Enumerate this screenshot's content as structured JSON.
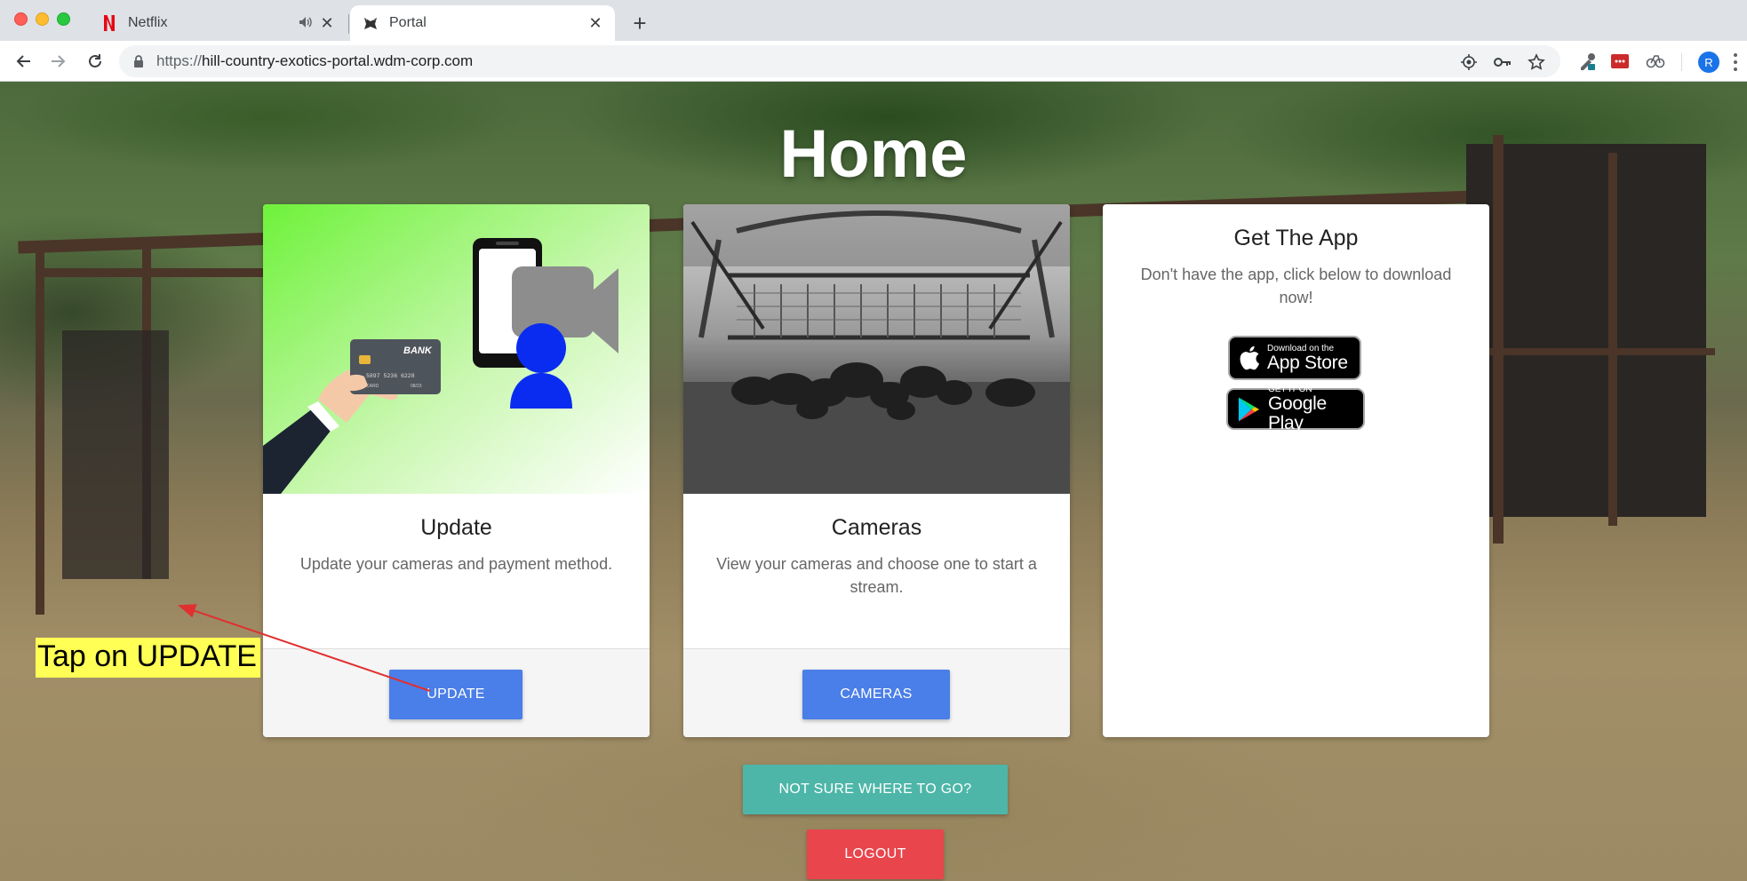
{
  "browser": {
    "tabs": [
      {
        "title": "Netflix",
        "active": false,
        "audio": true
      },
      {
        "title": "Portal",
        "active": true,
        "audio": false
      }
    ],
    "url": {
      "scheme": "https://",
      "host": "hill-country-exotics-portal.wdm-corp.com"
    },
    "profile_initial": "R"
  },
  "page": {
    "title": "Home",
    "cards": [
      {
        "title": "Update",
        "text": "Update your cameras and payment method.",
        "button": "UPDATE",
        "image_card_label": "BANK",
        "image_card_number": "5897 5236 6228",
        "image_card_small_left": "CARD",
        "image_card_small_right": "08/23"
      },
      {
        "title": "Cameras",
        "text": "View your cameras and choose one to start a stream.",
        "button": "CAMERAS"
      }
    ],
    "app_card": {
      "title": "Get The App",
      "text": "Don't have the app, click below to download now!",
      "app_store": {
        "small": "Download on the",
        "big": "App Store"
      },
      "google_play": {
        "small": "GET IT ON",
        "big": "Google Play"
      }
    },
    "help_button": "NOT SURE WHERE TO GO?",
    "logout_button": "LOGOUT"
  },
  "annotation": {
    "text": "Tap on UPDATE",
    "highlight_color": "#ffff55",
    "arrow_color": "#e03030"
  },
  "colors": {
    "primary_button": "#4a7ee8",
    "help_button": "#4db6a8",
    "logout_button": "#e8454c"
  }
}
